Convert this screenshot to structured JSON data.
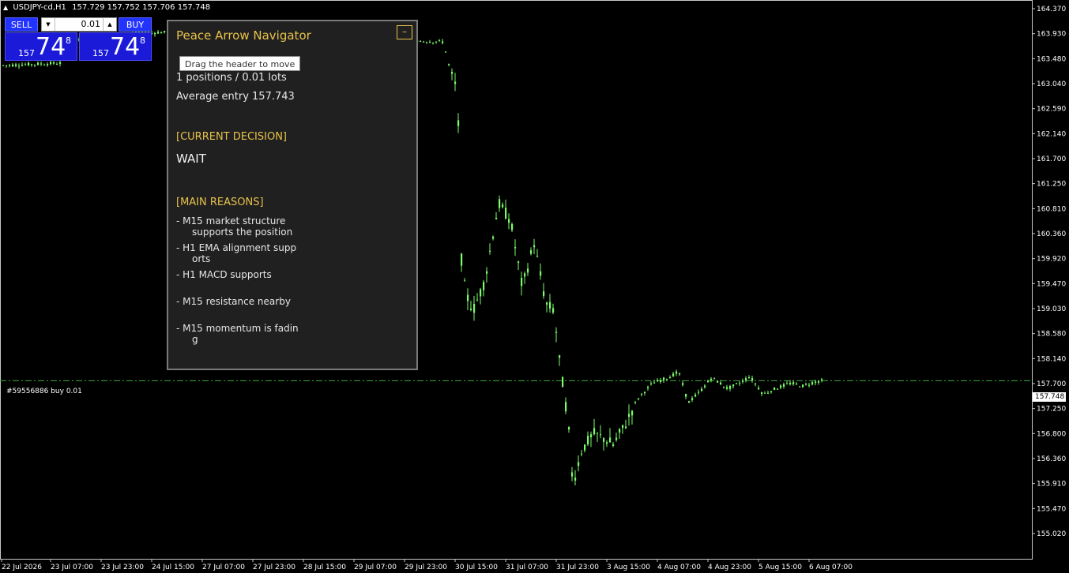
{
  "chart": {
    "symbol": "USDJPY-cd,H1",
    "ohlc": "157.729 157.752 157.706 157.748",
    "price_axis": [
      "164.370",
      "163.930",
      "163.480",
      "163.040",
      "162.590",
      "162.140",
      "161.700",
      "161.250",
      "160.810",
      "160.360",
      "159.920",
      "159.470",
      "159.030",
      "158.580",
      "158.140",
      "157.700",
      "157.250",
      "156.800",
      "156.360",
      "155.910",
      "155.470",
      "155.020"
    ],
    "time_axis": [
      "22 Jul 2026",
      "23 Jul 07:00",
      "23 Jul 23:00",
      "24 Jul 15:00",
      "27 Jul 07:00",
      "27 Jul 23:00",
      "28 Jul 15:00",
      "29 Jul 07:00",
      "29 Jul 23:00",
      "30 Jul 15:00",
      "31 Jul 07:00",
      "31 Jul 23:00",
      "3 Aug 15:00",
      "4 Aug 07:00",
      "4 Aug 23:00",
      "5 Aug 15:00",
      "6 Aug 07:00"
    ],
    "order_label": "#59556886 buy 0.01",
    "current_price_tag": "157.748",
    "candle_color": "#7cfc6a",
    "order_line_color": "#3ca83c"
  },
  "one_click": {
    "sell_label": "SELL",
    "buy_label": "BUY",
    "lot": "0.01",
    "sell_prefix": "157",
    "sell_big": "74",
    "sell_sup": "8",
    "buy_prefix": "157",
    "buy_big": "74",
    "buy_sup": "8"
  },
  "navigator": {
    "title": "Peace Arrow Navigator",
    "minimize_label": "–",
    "tooltip": "Drag the header to move",
    "positions": "1 positions  /  0.01 lots",
    "average_entry": "Average entry  157.743",
    "decision_header": "[CURRENT DECISION]",
    "decision": "WAIT",
    "reasons_header": "[MAIN REASONS]",
    "reasons": [
      {
        "line1": "- M15 market structure",
        "line2": "supports the position"
      },
      {
        "line1": "- H1 EMA alignment supp",
        "line2": "orts"
      },
      {
        "line1": "- H1 MACD supports",
        "line2": ""
      },
      {
        "line1": "- M15 resistance nearby",
        "line2": ""
      },
      {
        "line1": "- M15 momentum is fadin",
        "line2": "g"
      }
    ]
  }
}
